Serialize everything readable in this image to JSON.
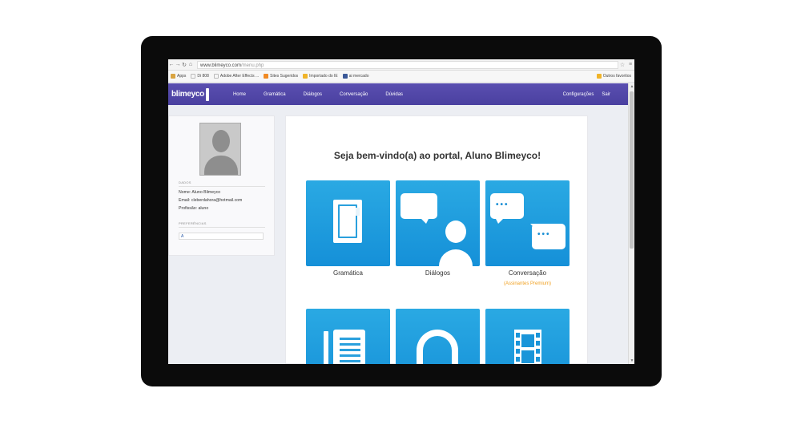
{
  "browser": {
    "url_host": "www.blimeyco.com",
    "url_path": "/menu.php",
    "bookmarks": [
      {
        "label": "Apps",
        "color": "#d9a441"
      },
      {
        "label": "Di 808",
        "color": "#cccccc"
      },
      {
        "label": "Adobe After Effects ...",
        "color": "#cccccc"
      },
      {
        "label": "Sites Sugeridos",
        "color": "#f08a24"
      },
      {
        "label": "Importado do IE",
        "color": "#f0b429"
      },
      {
        "label": "ai mercado",
        "color": "#3b5998"
      }
    ],
    "other_bookmarks": "Outros favoritos"
  },
  "nav": {
    "logo": "blimeyco",
    "items": [
      "Home",
      "Gramática",
      "Diálogos",
      "Conversação",
      "Dúvidas"
    ],
    "right": [
      "Configurações",
      "Sair"
    ],
    "color": "#4f45a8"
  },
  "profile": {
    "section_dados": "DADOS",
    "name_line": "Nome: Aluno Blimeyco",
    "email_line": "Email: cleberdahora@hotmail.com",
    "profession_line": "Profissão: aluno",
    "section_preferences": "PREFERÊNCIAS",
    "preference_value": "A"
  },
  "main": {
    "welcome": "Seja bem-vindo(a) ao portal, Aluno Blimeyco!",
    "tiles": [
      {
        "label": "Gramática",
        "icon": "book-icon"
      },
      {
        "label": "Diálogos",
        "icon": "dialog-person-icon"
      },
      {
        "label": "Conversação",
        "note": "(Assinantes Premium)",
        "icon": "chat-bubbles-icon"
      },
      {
        "label": "",
        "icon": "document-icon"
      },
      {
        "label": "",
        "icon": "headphones-icon"
      },
      {
        "label": "",
        "icon": "film-icon"
      }
    ],
    "tile_color": "#1e9ee0",
    "premium_color": "#f0a020"
  }
}
